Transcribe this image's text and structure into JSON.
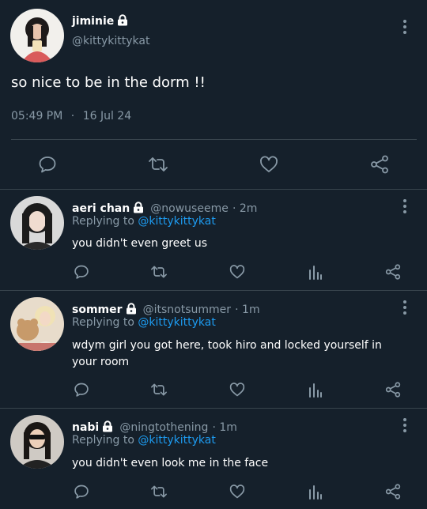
{
  "main_tweet": {
    "display_name": "jiminie",
    "handle": "@kittykittykat",
    "text": "so nice to be in the dorm !!",
    "time": "05:49 PM",
    "separator": "·",
    "date": "16 Jul 24"
  },
  "replies": [
    {
      "display_name": "aeri chan",
      "handle": "@nowuseeme",
      "time": "· 2m",
      "replying_prefix": "Replying to",
      "replying_to": "@kittykittykat",
      "text": "you didn't even greet us"
    },
    {
      "display_name": "sommer",
      "handle": "@itsnotsummer",
      "time": "· 1m",
      "replying_prefix": "Replying to",
      "replying_to": "@kittykittykat",
      "text": "wdym girl you got here, took hiro and locked yourself in your room"
    },
    {
      "display_name": "nabi",
      "handle": "@ningtothening",
      "time": "· 1m",
      "replying_prefix": "Replying to",
      "replying_to": "@kittykittykat",
      "text": "you didn't even look me in the face"
    }
  ],
  "colors": {
    "background": "#15202b",
    "muted": "#8899a6",
    "link": "#1d9bf0",
    "divider": "#38444d"
  },
  "icons": [
    "lock-icon",
    "more-icon",
    "reply-icon",
    "retweet-icon",
    "like-icon",
    "share-icon",
    "analytics-icon"
  ]
}
